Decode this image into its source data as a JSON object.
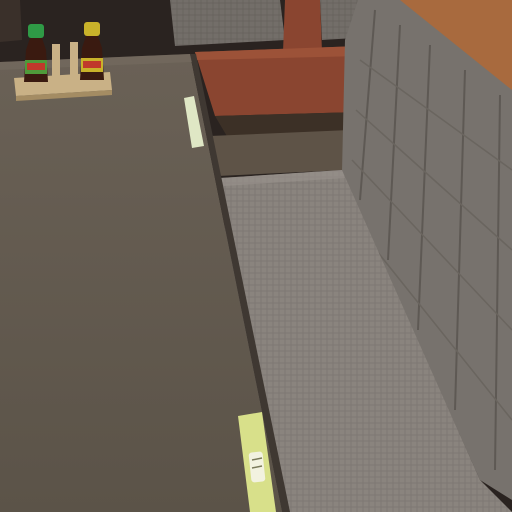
{
  "scene": {
    "colors": {
      "background_dark": "#2a2320",
      "wood_panel": "#8a4530",
      "wood_panel_dark": "#6b3422",
      "table_top": "#6e6559",
      "table_edge": "#57504a",
      "bench_upholstery": "#8a847e",
      "bench_back": "#77726d",
      "bench_back_seam": "#5e5954",
      "cushion_top": "#7c7670",
      "soy_bottle_glass": "#3a1a10",
      "soy_cap_green": "#2f9a46",
      "soy_cap_yellow": "#c9b22a",
      "soy_label_green": "#4f9a3a",
      "soy_label_red": "#c0392b",
      "holder_wood": "#c9b186",
      "chopstick_sleeve": "#dfe7c5",
      "receipt_paper": "#d8e08a"
    },
    "objects": [
      {
        "name": "soy-sauce-bottle",
        "cap": "green"
      },
      {
        "name": "soy-sauce-bottle",
        "cap": "yellow"
      },
      {
        "name": "condiment-holder"
      },
      {
        "name": "chopstick-sleeve"
      },
      {
        "name": "order-receipt-slip"
      },
      {
        "name": "booth-bench-seat"
      },
      {
        "name": "booth-bench-backrest"
      },
      {
        "name": "wooden-partition"
      },
      {
        "name": "dining-table"
      }
    ]
  }
}
